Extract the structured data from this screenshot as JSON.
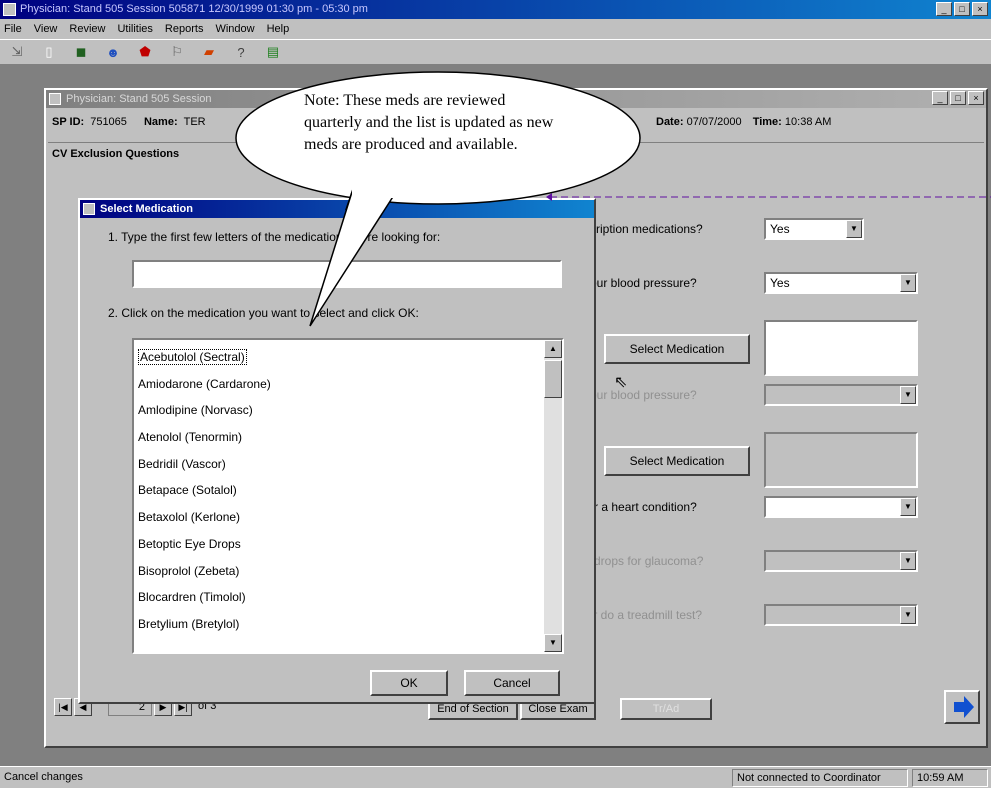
{
  "app": {
    "title": "Physician: Stand 505 Session 505871 12/30/1999 01:30 pm - 05:30 pm",
    "window_controls": [
      "_",
      "□",
      "×"
    ]
  },
  "menu": [
    "File",
    "View",
    "Review",
    "Utilities",
    "Reports",
    "Window",
    "Help"
  ],
  "toolbar_icons": [
    "exit-icon",
    "new-icon",
    "open-icon",
    "people-icon",
    "stop-icon",
    "flag-icon",
    "chart-icon",
    "help-icon",
    "notes-icon"
  ],
  "child": {
    "title": "Physician: Stand 505 Session",
    "sp_id_label": "SP ID:",
    "sp_id_value": "751065",
    "name_label": "Name:",
    "name_value": "TER",
    "date_label": "Date:",
    "date_value": "07/07/2000",
    "time_label": "Time:",
    "time_value": "10:38 AM",
    "section": "CV Exclusion Questions"
  },
  "questions": [
    {
      "text": "scription medications?",
      "answer": "Yes",
      "dim": false
    },
    {
      "text": "your blood pressure?",
      "answer": "Yes",
      "dim": false
    },
    {
      "text": "your blood pressure?",
      "answer": "",
      "dim": true
    },
    {
      "text": "for a heart condition?",
      "answer": "",
      "dim": false
    },
    {
      "text": "e drops for glaucoma?",
      "answer": "",
      "dim": true
    },
    {
      "text": "ior do a treadmill test?",
      "answer": "",
      "dim": true
    }
  ],
  "select_med_buttons": [
    "Select Medication",
    "Select Medication"
  ],
  "dialog": {
    "title": "Select Medication",
    "step1": "1.  Type the first few letters of the medication you're looking for:",
    "step2": "2.  Click on the medication you want to select and click OK:",
    "medications": [
      "Acebutolol (Sectral)",
      "Amiodarone (Cardarone)",
      "Amlodipine (Norvasc)",
      "Atenolol (Tenormin)",
      "Bedridil (Vascor)",
      "Betapace (Sotalol)",
      "Betaxolol (Kerlone)",
      "Betoptic Eye Drops",
      "Bisoprolol (Zebeta)",
      "Blocardren (Timolol)",
      "Bretylium (Bretylol)"
    ],
    "ok": "OK",
    "cancel": "Cancel"
  },
  "callout": {
    "text": "Note: These meds are reviewed quarterly and  the list is updated as new meds are produced and available."
  },
  "nav": {
    "page": "2",
    "of_label": "of 3",
    "end_section": "End of Section",
    "close_exam": "Close Exam",
    "disabled_btn": "Tr/Ad"
  },
  "status": {
    "left": "Cancel changes",
    "connection": "Not connected to Coordinator",
    "time": "10:59 AM"
  }
}
